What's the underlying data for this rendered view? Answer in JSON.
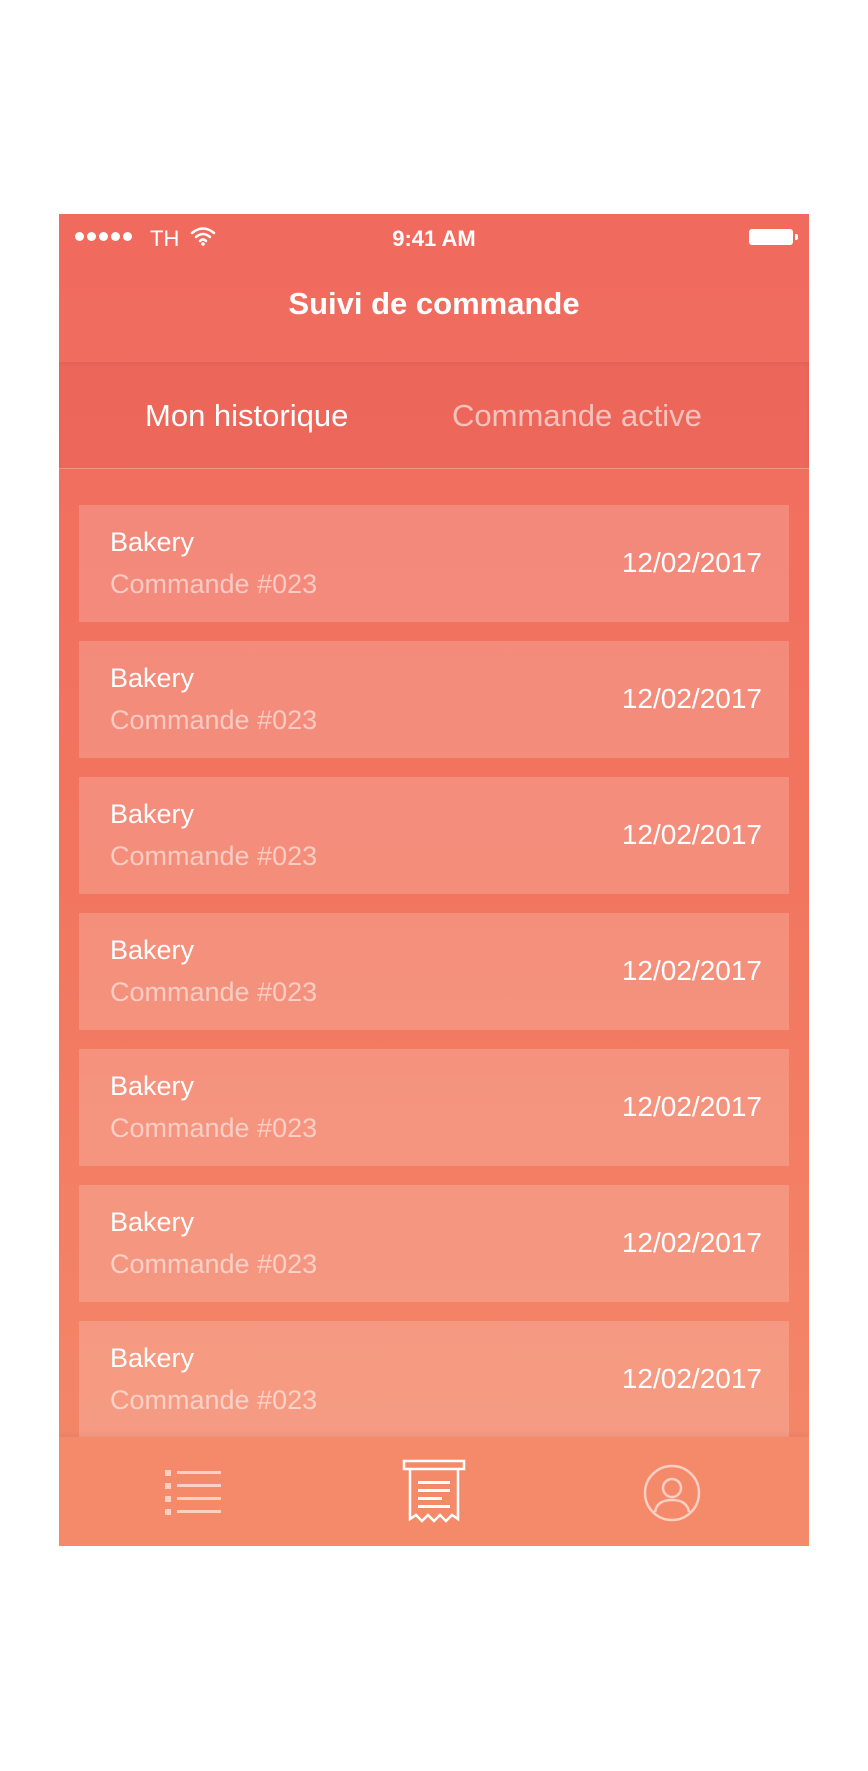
{
  "status_bar": {
    "carrier": "TH",
    "time": "9:41 AM"
  },
  "nav": {
    "title": "Suivi de commande"
  },
  "tabs": [
    {
      "label": "Mon historique",
      "active": true
    },
    {
      "label": "Commande active",
      "active": false
    }
  ],
  "orders": [
    {
      "name": "Bakery",
      "number": "Commande #023",
      "date": "12/02/2017"
    },
    {
      "name": "Bakery",
      "number": "Commande #023",
      "date": "12/02/2017"
    },
    {
      "name": "Bakery",
      "number": "Commande #023",
      "date": "12/02/2017"
    },
    {
      "name": "Bakery",
      "number": "Commande #023",
      "date": "12/02/2017"
    },
    {
      "name": "Bakery",
      "number": "Commande #023",
      "date": "12/02/2017"
    },
    {
      "name": "Bakery",
      "number": "Commande #023",
      "date": "12/02/2017"
    },
    {
      "name": "Bakery",
      "number": "Commande #023",
      "date": "12/02/2017"
    }
  ],
  "bottom_tabs": [
    {
      "icon": "list-icon",
      "active": false
    },
    {
      "icon": "receipt-icon",
      "active": true
    },
    {
      "icon": "user-icon",
      "active": false
    }
  ],
  "colors": {
    "accent_top": "#f06a5e",
    "accent_bottom": "#f4896a",
    "text": "#ffffff"
  }
}
